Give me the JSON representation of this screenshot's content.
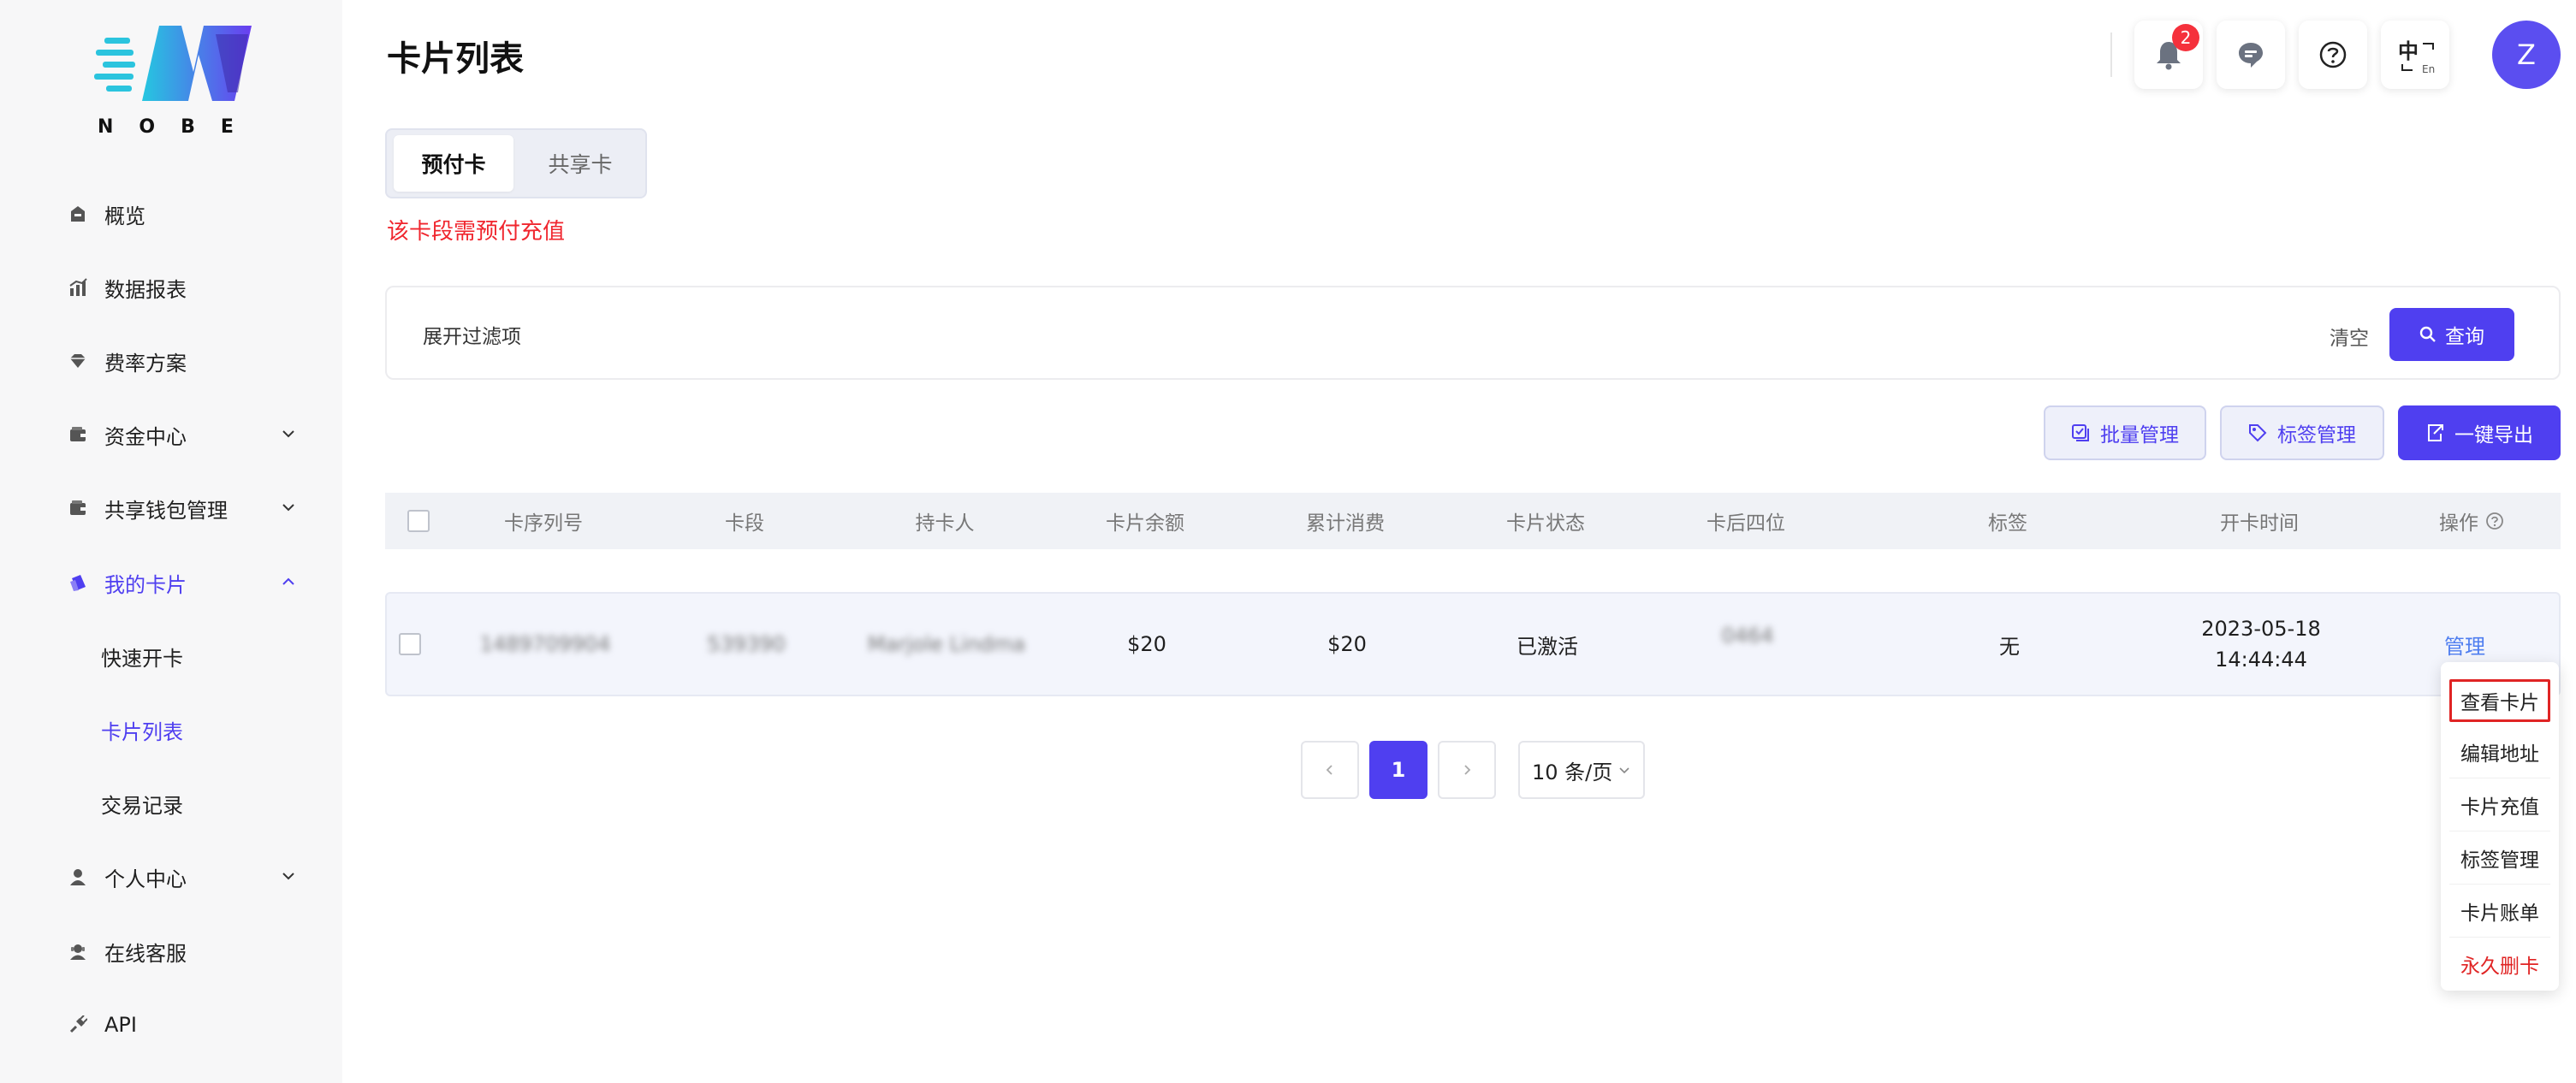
{
  "brand": {
    "logo_text": "NOBE"
  },
  "sidebar": {
    "items": [
      {
        "label": "概览",
        "icon": "home-icon"
      },
      {
        "label": "数据报表",
        "icon": "chart-icon"
      },
      {
        "label": "费率方案",
        "icon": "diamond-icon"
      },
      {
        "label": "资金中心",
        "icon": "wallet-icon"
      },
      {
        "label": "共享钱包管理",
        "icon": "wallet-icon"
      },
      {
        "label": "我的卡片",
        "icon": "cards-icon"
      },
      {
        "label": "个人中心",
        "icon": "user-icon"
      },
      {
        "label": "在线客服",
        "icon": "support-icon"
      },
      {
        "label": "API",
        "icon": "api-icon"
      }
    ],
    "sub_items": [
      {
        "label": "快速开卡"
      },
      {
        "label": "卡片列表"
      },
      {
        "label": "交易记录"
      }
    ]
  },
  "header": {
    "title": "卡片列表",
    "notification_count": "2",
    "lang_main": "中",
    "lang_sub": "En",
    "avatar_letter": "Z"
  },
  "tabs": [
    {
      "label": "预付卡"
    },
    {
      "label": "共享卡"
    }
  ],
  "notice": "该卡段需预付充值",
  "filter": {
    "toggle_label": "展开过滤项",
    "clear_label": "清空",
    "query_label": "查询"
  },
  "actions": {
    "batch_label": "批量管理",
    "tag_label": "标签管理",
    "export_label": "一键导出"
  },
  "table": {
    "columns": [
      "卡序列号",
      "卡段",
      "持卡人",
      "卡片余额",
      "累计消费",
      "卡片状态",
      "卡后四位",
      "标签",
      "开卡时间",
      "操作"
    ],
    "rows": [
      {
        "serial": "1489709904",
        "segment": "539390",
        "holder": "Marjole Lindma",
        "balance": "$20",
        "spent": "$20",
        "status": "已激活",
        "last4": "0464",
        "tag": "无",
        "date": "2023-05-18",
        "time": "14:44:44",
        "action": "管理"
      }
    ]
  },
  "dropdown": {
    "items": [
      {
        "label": "查看卡片"
      },
      {
        "label": "编辑地址"
      },
      {
        "label": "卡片充值"
      },
      {
        "label": "标签管理"
      },
      {
        "label": "卡片账单"
      },
      {
        "label": "永久删卡"
      }
    ]
  },
  "pagination": {
    "current_page": "1",
    "page_size_label": "10 条/页"
  },
  "colors": {
    "accent": "#4f3ff0",
    "danger": "#e02424",
    "link": "#4f7ef0"
  }
}
